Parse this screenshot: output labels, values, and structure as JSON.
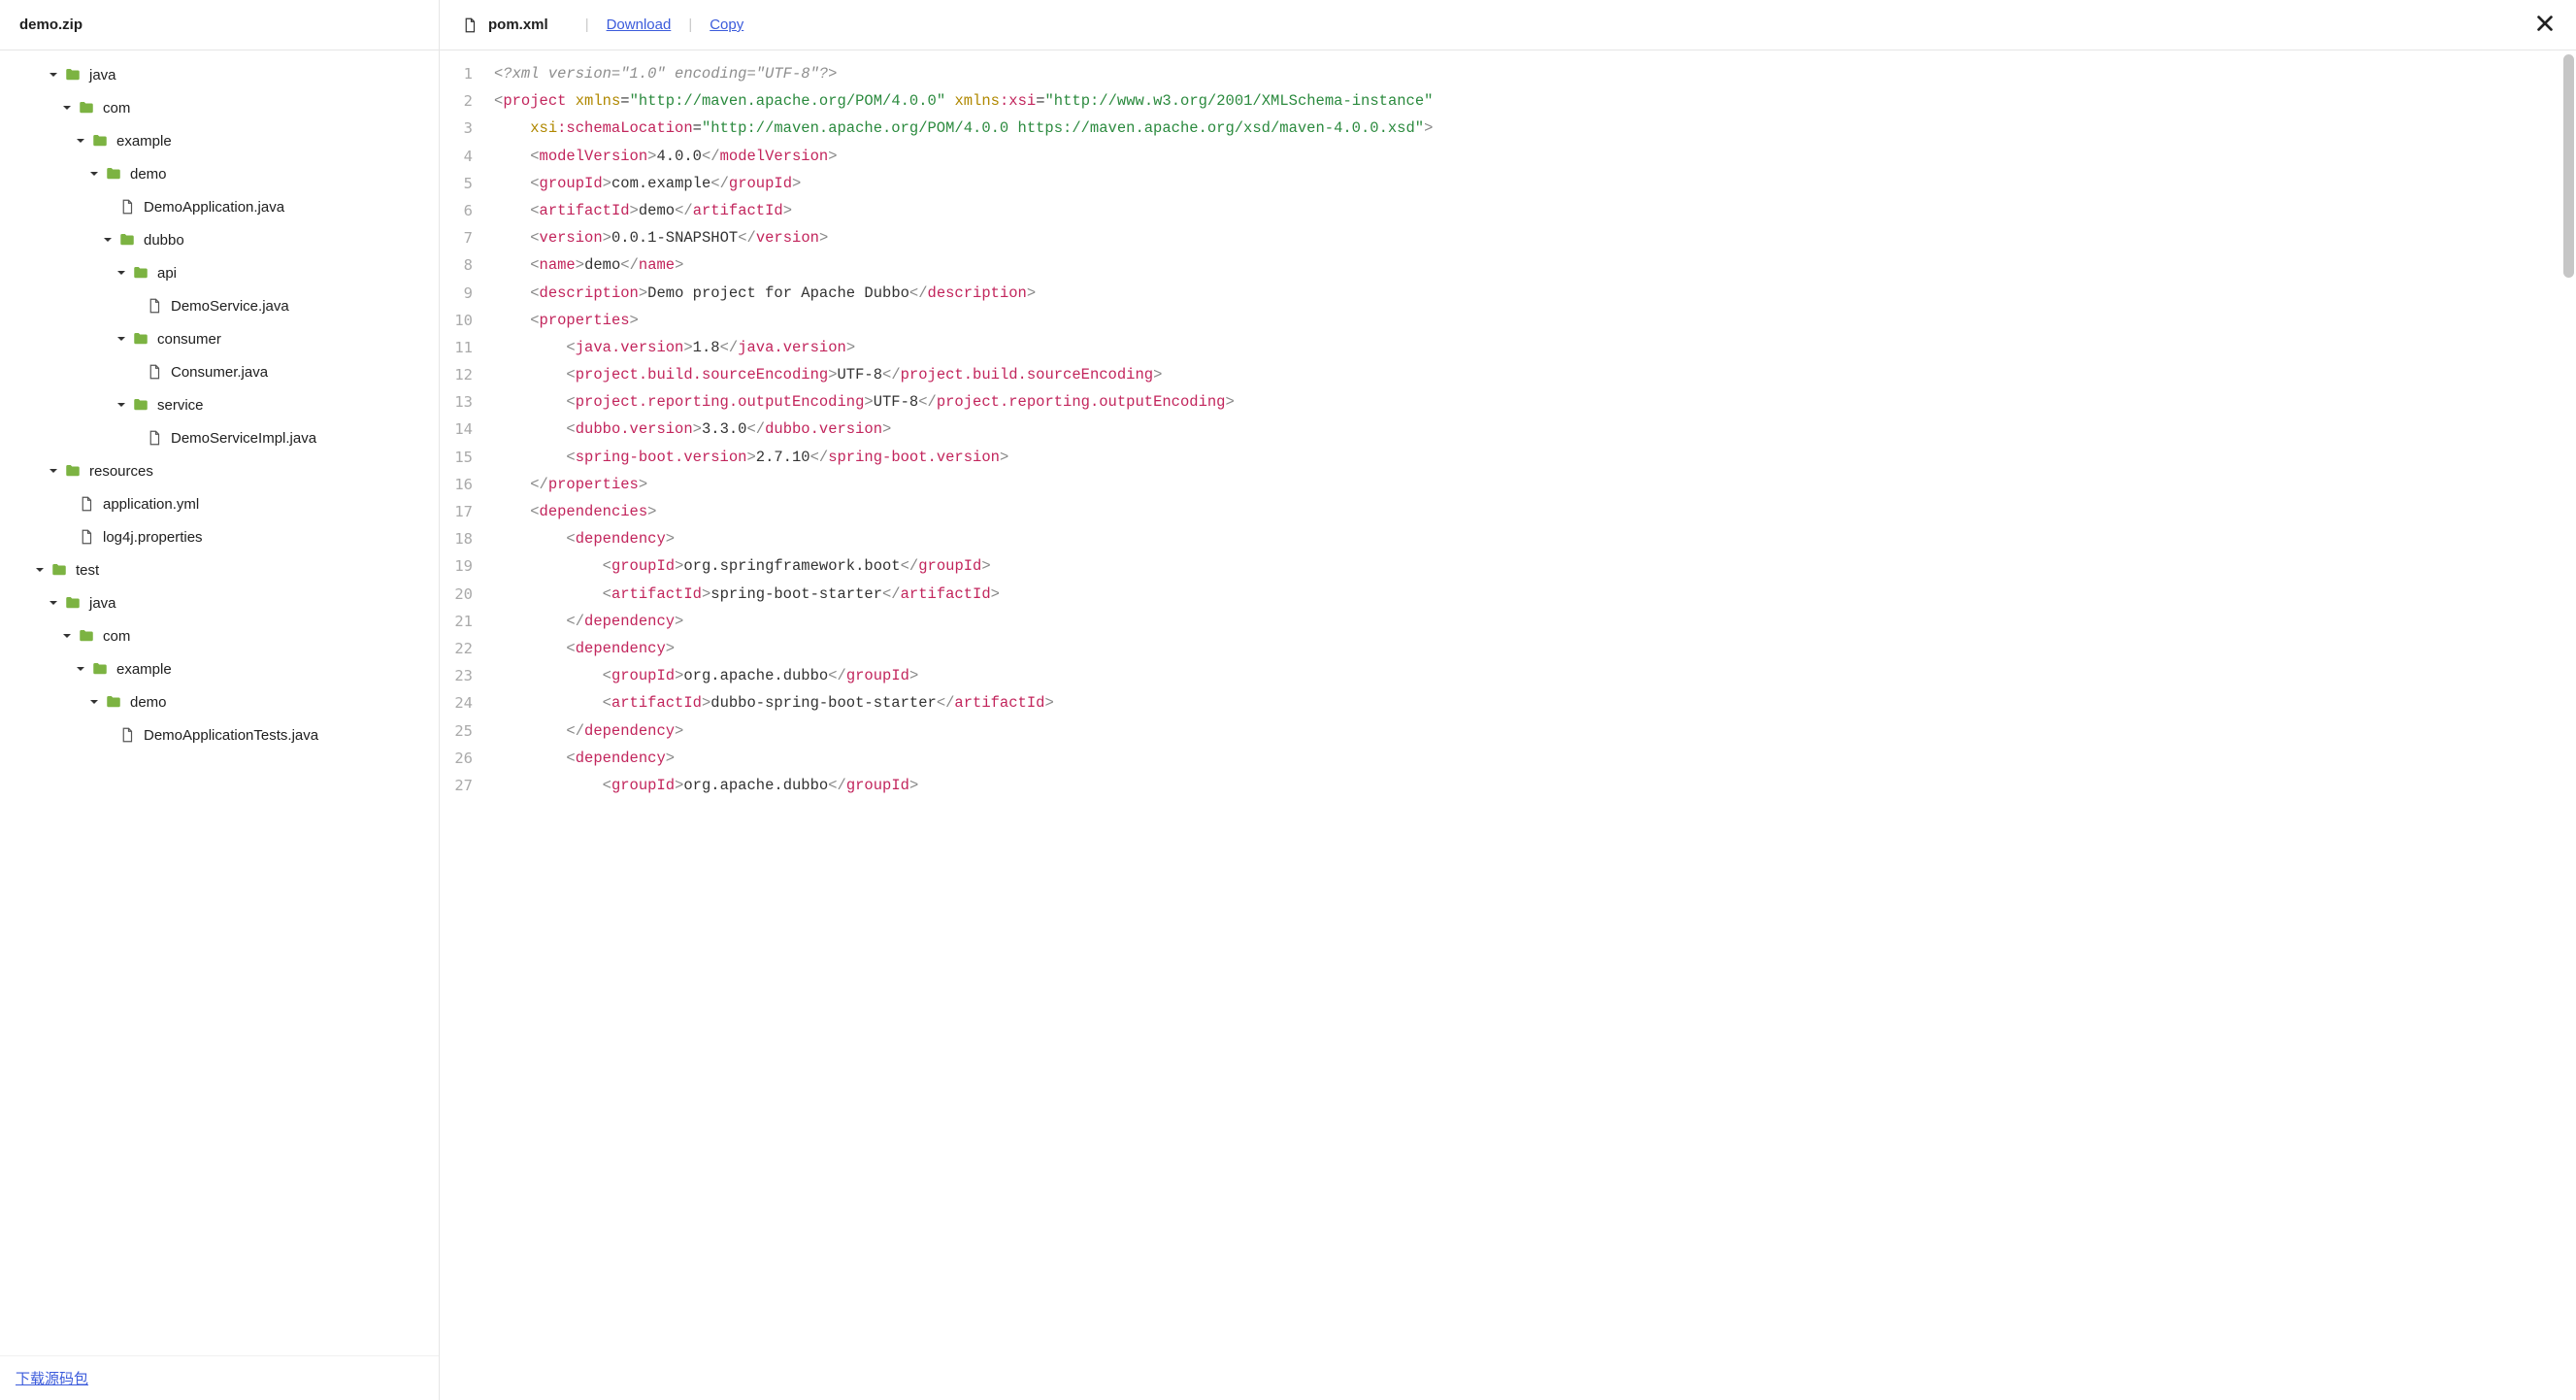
{
  "left": {
    "header_title": "demo.zip",
    "footer_link": "下载源码包",
    "tree": [
      {
        "depth": 0,
        "type": "folder",
        "expanded": true,
        "label": "java"
      },
      {
        "depth": 1,
        "type": "folder",
        "expanded": true,
        "label": "com"
      },
      {
        "depth": 2,
        "type": "folder",
        "expanded": true,
        "label": "example"
      },
      {
        "depth": 3,
        "type": "folder",
        "expanded": true,
        "label": "demo"
      },
      {
        "depth": 4,
        "type": "file",
        "expanded": false,
        "label": "DemoApplication.java"
      },
      {
        "depth": 4,
        "type": "folder",
        "expanded": true,
        "label": "dubbo"
      },
      {
        "depth": 5,
        "type": "folder",
        "expanded": true,
        "label": "api"
      },
      {
        "depth": 6,
        "type": "file",
        "expanded": false,
        "label": "DemoService.java"
      },
      {
        "depth": 5,
        "type": "folder",
        "expanded": true,
        "label": "consumer"
      },
      {
        "depth": 6,
        "type": "file",
        "expanded": false,
        "label": "Consumer.java"
      },
      {
        "depth": 5,
        "type": "folder",
        "expanded": true,
        "label": "service"
      },
      {
        "depth": 6,
        "type": "file",
        "expanded": false,
        "label": "DemoServiceImpl.java"
      },
      {
        "depth": 0,
        "type": "folder",
        "expanded": true,
        "label": "resources"
      },
      {
        "depth": 1,
        "type": "file",
        "expanded": false,
        "label": "application.yml"
      },
      {
        "depth": 1,
        "type": "file",
        "expanded": false,
        "label": "log4j.properties"
      },
      {
        "depth": -1,
        "type": "folder",
        "expanded": true,
        "label": "test"
      },
      {
        "depth": 0,
        "type": "folder",
        "expanded": true,
        "label": "java"
      },
      {
        "depth": 1,
        "type": "folder",
        "expanded": true,
        "label": "com"
      },
      {
        "depth": 2,
        "type": "folder",
        "expanded": true,
        "label": "example"
      },
      {
        "depth": 3,
        "type": "folder",
        "expanded": true,
        "label": "demo"
      },
      {
        "depth": 4,
        "type": "file",
        "expanded": false,
        "label": "DemoApplicationTests.java"
      }
    ]
  },
  "right": {
    "file_name": "pom.xml",
    "download_label": "Download",
    "copy_label": "Copy"
  },
  "code": {
    "line_numbers": [
      "1",
      "2",
      "3",
      "4",
      "5",
      "6",
      "7",
      "8",
      "9",
      "10",
      "11",
      "12",
      "13",
      "14",
      "15",
      "16",
      "17",
      "18",
      "19",
      "20",
      "21",
      "22",
      "23",
      "24",
      "25",
      "26",
      "27"
    ],
    "lines": [
      [
        {
          "cls": "cm-decl",
          "t": "<?xml version=\"1.0\" encoding=\"UTF-8\"?>"
        }
      ],
      [
        {
          "cls": "cm-bra",
          "t": "<"
        },
        {
          "cls": "cm-tag",
          "t": "project"
        },
        {
          "cls": "",
          "t": " "
        },
        {
          "cls": "cm-attr",
          "t": "xmlns"
        },
        {
          "cls": "cm-eq",
          "t": "="
        },
        {
          "cls": "cm-str",
          "t": "\"http://maven.apache.org/POM/4.0.0\""
        },
        {
          "cls": "",
          "t": " "
        },
        {
          "cls": "cm-attr",
          "t": "xmlns"
        },
        {
          "cls": "cm-tag",
          "t": ":xsi"
        },
        {
          "cls": "cm-eq",
          "t": "="
        },
        {
          "cls": "cm-str",
          "t": "\"http://www.w3.org/2001/XMLSchema-instance\""
        }
      ],
      [
        {
          "cls": "",
          "t": "    "
        },
        {
          "cls": "cm-attr",
          "t": "xsi"
        },
        {
          "cls": "cm-tag",
          "t": ":schemaLocation"
        },
        {
          "cls": "cm-eq",
          "t": "="
        },
        {
          "cls": "cm-str",
          "t": "\"http://maven.apache.org/POM/4.0.0 https://maven.apache.org/xsd/maven-4.0.0.xsd\""
        },
        {
          "cls": "cm-bra",
          "t": ">"
        }
      ],
      [
        {
          "cls": "",
          "t": "    "
        },
        {
          "cls": "cm-bra",
          "t": "<"
        },
        {
          "cls": "cm-tag",
          "t": "modelVersion"
        },
        {
          "cls": "cm-bra",
          "t": ">"
        },
        {
          "cls": "cm-text",
          "t": "4.0.0"
        },
        {
          "cls": "cm-bra",
          "t": "</"
        },
        {
          "cls": "cm-tag",
          "t": "modelVersion"
        },
        {
          "cls": "cm-bra",
          "t": ">"
        }
      ],
      [
        {
          "cls": "",
          "t": "    "
        },
        {
          "cls": "cm-bra",
          "t": "<"
        },
        {
          "cls": "cm-tag",
          "t": "groupId"
        },
        {
          "cls": "cm-bra",
          "t": ">"
        },
        {
          "cls": "cm-text",
          "t": "com.example"
        },
        {
          "cls": "cm-bra",
          "t": "</"
        },
        {
          "cls": "cm-tag",
          "t": "groupId"
        },
        {
          "cls": "cm-bra",
          "t": ">"
        }
      ],
      [
        {
          "cls": "",
          "t": "    "
        },
        {
          "cls": "cm-bra",
          "t": "<"
        },
        {
          "cls": "cm-tag",
          "t": "artifactId"
        },
        {
          "cls": "cm-bra",
          "t": ">"
        },
        {
          "cls": "cm-text",
          "t": "demo"
        },
        {
          "cls": "cm-bra",
          "t": "</"
        },
        {
          "cls": "cm-tag",
          "t": "artifactId"
        },
        {
          "cls": "cm-bra",
          "t": ">"
        }
      ],
      [
        {
          "cls": "",
          "t": "    "
        },
        {
          "cls": "cm-bra",
          "t": "<"
        },
        {
          "cls": "cm-tag",
          "t": "version"
        },
        {
          "cls": "cm-bra",
          "t": ">"
        },
        {
          "cls": "cm-text",
          "t": "0.0.1-SNAPSHOT"
        },
        {
          "cls": "cm-bra",
          "t": "</"
        },
        {
          "cls": "cm-tag",
          "t": "version"
        },
        {
          "cls": "cm-bra",
          "t": ">"
        }
      ],
      [
        {
          "cls": "",
          "t": "    "
        },
        {
          "cls": "cm-bra",
          "t": "<"
        },
        {
          "cls": "cm-tag",
          "t": "name"
        },
        {
          "cls": "cm-bra",
          "t": ">"
        },
        {
          "cls": "cm-text",
          "t": "demo"
        },
        {
          "cls": "cm-bra",
          "t": "</"
        },
        {
          "cls": "cm-tag",
          "t": "name"
        },
        {
          "cls": "cm-bra",
          "t": ">"
        }
      ],
      [
        {
          "cls": "",
          "t": "    "
        },
        {
          "cls": "cm-bra",
          "t": "<"
        },
        {
          "cls": "cm-tag",
          "t": "description"
        },
        {
          "cls": "cm-bra",
          "t": ">"
        },
        {
          "cls": "cm-text",
          "t": "Demo project for Apache Dubbo"
        },
        {
          "cls": "cm-bra",
          "t": "</"
        },
        {
          "cls": "cm-tag",
          "t": "description"
        },
        {
          "cls": "cm-bra",
          "t": ">"
        }
      ],
      [
        {
          "cls": "",
          "t": "    "
        },
        {
          "cls": "cm-bra",
          "t": "<"
        },
        {
          "cls": "cm-tag",
          "t": "properties"
        },
        {
          "cls": "cm-bra",
          "t": ">"
        }
      ],
      [
        {
          "cls": "",
          "t": "        "
        },
        {
          "cls": "cm-bra",
          "t": "<"
        },
        {
          "cls": "cm-tag",
          "t": "java.version"
        },
        {
          "cls": "cm-bra",
          "t": ">"
        },
        {
          "cls": "cm-text",
          "t": "1.8"
        },
        {
          "cls": "cm-bra",
          "t": "</"
        },
        {
          "cls": "cm-tag",
          "t": "java.version"
        },
        {
          "cls": "cm-bra",
          "t": ">"
        }
      ],
      [
        {
          "cls": "",
          "t": "        "
        },
        {
          "cls": "cm-bra",
          "t": "<"
        },
        {
          "cls": "cm-tag",
          "t": "project.build.sourceEncoding"
        },
        {
          "cls": "cm-bra",
          "t": ">"
        },
        {
          "cls": "cm-text",
          "t": "UTF-8"
        },
        {
          "cls": "cm-bra",
          "t": "</"
        },
        {
          "cls": "cm-tag",
          "t": "project.build.sourceEncoding"
        },
        {
          "cls": "cm-bra",
          "t": ">"
        }
      ],
      [
        {
          "cls": "",
          "t": "        "
        },
        {
          "cls": "cm-bra",
          "t": "<"
        },
        {
          "cls": "cm-tag",
          "t": "project.reporting.outputEncoding"
        },
        {
          "cls": "cm-bra",
          "t": ">"
        },
        {
          "cls": "cm-text",
          "t": "UTF-8"
        },
        {
          "cls": "cm-bra",
          "t": "</"
        },
        {
          "cls": "cm-tag",
          "t": "project.reporting.outputEncoding"
        },
        {
          "cls": "cm-bra",
          "t": ">"
        }
      ],
      [
        {
          "cls": "",
          "t": "        "
        },
        {
          "cls": "cm-bra",
          "t": "<"
        },
        {
          "cls": "cm-tag",
          "t": "dubbo.version"
        },
        {
          "cls": "cm-bra",
          "t": ">"
        },
        {
          "cls": "cm-text",
          "t": "3.3.0"
        },
        {
          "cls": "cm-bra",
          "t": "</"
        },
        {
          "cls": "cm-tag",
          "t": "dubbo.version"
        },
        {
          "cls": "cm-bra",
          "t": ">"
        }
      ],
      [
        {
          "cls": "",
          "t": "        "
        },
        {
          "cls": "cm-bra",
          "t": "<"
        },
        {
          "cls": "cm-tag",
          "t": "spring-boot.version"
        },
        {
          "cls": "cm-bra",
          "t": ">"
        },
        {
          "cls": "cm-text",
          "t": "2.7.10"
        },
        {
          "cls": "cm-bra",
          "t": "</"
        },
        {
          "cls": "cm-tag",
          "t": "spring-boot.version"
        },
        {
          "cls": "cm-bra",
          "t": ">"
        }
      ],
      [
        {
          "cls": "",
          "t": "    "
        },
        {
          "cls": "cm-bra",
          "t": "</"
        },
        {
          "cls": "cm-tag",
          "t": "properties"
        },
        {
          "cls": "cm-bra",
          "t": ">"
        }
      ],
      [
        {
          "cls": "",
          "t": "    "
        },
        {
          "cls": "cm-bra",
          "t": "<"
        },
        {
          "cls": "cm-tag",
          "t": "dependencies"
        },
        {
          "cls": "cm-bra",
          "t": ">"
        }
      ],
      [
        {
          "cls": "",
          "t": "        "
        },
        {
          "cls": "cm-bra",
          "t": "<"
        },
        {
          "cls": "cm-tag",
          "t": "dependency"
        },
        {
          "cls": "cm-bra",
          "t": ">"
        }
      ],
      [
        {
          "cls": "",
          "t": "            "
        },
        {
          "cls": "cm-bra",
          "t": "<"
        },
        {
          "cls": "cm-tag",
          "t": "groupId"
        },
        {
          "cls": "cm-bra",
          "t": ">"
        },
        {
          "cls": "cm-text",
          "t": "org.springframework.boot"
        },
        {
          "cls": "cm-bra",
          "t": "</"
        },
        {
          "cls": "cm-tag",
          "t": "groupId"
        },
        {
          "cls": "cm-bra",
          "t": ">"
        }
      ],
      [
        {
          "cls": "",
          "t": "            "
        },
        {
          "cls": "cm-bra",
          "t": "<"
        },
        {
          "cls": "cm-tag",
          "t": "artifactId"
        },
        {
          "cls": "cm-bra",
          "t": ">"
        },
        {
          "cls": "cm-text",
          "t": "spring-boot-starter"
        },
        {
          "cls": "cm-bra",
          "t": "</"
        },
        {
          "cls": "cm-tag",
          "t": "artifactId"
        },
        {
          "cls": "cm-bra",
          "t": ">"
        }
      ],
      [
        {
          "cls": "",
          "t": "        "
        },
        {
          "cls": "cm-bra",
          "t": "</"
        },
        {
          "cls": "cm-tag",
          "t": "dependency"
        },
        {
          "cls": "cm-bra",
          "t": ">"
        }
      ],
      [
        {
          "cls": "",
          "t": "        "
        },
        {
          "cls": "cm-bra",
          "t": "<"
        },
        {
          "cls": "cm-tag",
          "t": "dependency"
        },
        {
          "cls": "cm-bra",
          "t": ">"
        }
      ],
      [
        {
          "cls": "",
          "t": "            "
        },
        {
          "cls": "cm-bra",
          "t": "<"
        },
        {
          "cls": "cm-tag",
          "t": "groupId"
        },
        {
          "cls": "cm-bra",
          "t": ">"
        },
        {
          "cls": "cm-text",
          "t": "org.apache.dubbo"
        },
        {
          "cls": "cm-bra",
          "t": "</"
        },
        {
          "cls": "cm-tag",
          "t": "groupId"
        },
        {
          "cls": "cm-bra",
          "t": ">"
        }
      ],
      [
        {
          "cls": "",
          "t": "            "
        },
        {
          "cls": "cm-bra",
          "t": "<"
        },
        {
          "cls": "cm-tag",
          "t": "artifactId"
        },
        {
          "cls": "cm-bra",
          "t": ">"
        },
        {
          "cls": "cm-text",
          "t": "dubbo-spring-boot-starter"
        },
        {
          "cls": "cm-bra",
          "t": "</"
        },
        {
          "cls": "cm-tag",
          "t": "artifactId"
        },
        {
          "cls": "cm-bra",
          "t": ">"
        }
      ],
      [
        {
          "cls": "",
          "t": "        "
        },
        {
          "cls": "cm-bra",
          "t": "</"
        },
        {
          "cls": "cm-tag",
          "t": "dependency"
        },
        {
          "cls": "cm-bra",
          "t": ">"
        }
      ],
      [
        {
          "cls": "",
          "t": "        "
        },
        {
          "cls": "cm-bra",
          "t": "<"
        },
        {
          "cls": "cm-tag",
          "t": "dependency"
        },
        {
          "cls": "cm-bra",
          "t": ">"
        }
      ],
      [
        {
          "cls": "",
          "t": "            "
        },
        {
          "cls": "cm-bra",
          "t": "<"
        },
        {
          "cls": "cm-tag",
          "t": "groupId"
        },
        {
          "cls": "cm-bra",
          "t": ">"
        },
        {
          "cls": "cm-text",
          "t": "org.apache.dubbo"
        },
        {
          "cls": "cm-bra",
          "t": "</"
        },
        {
          "cls": "cm-tag",
          "t": "groupId"
        },
        {
          "cls": "cm-bra",
          "t": ">"
        }
      ]
    ]
  }
}
